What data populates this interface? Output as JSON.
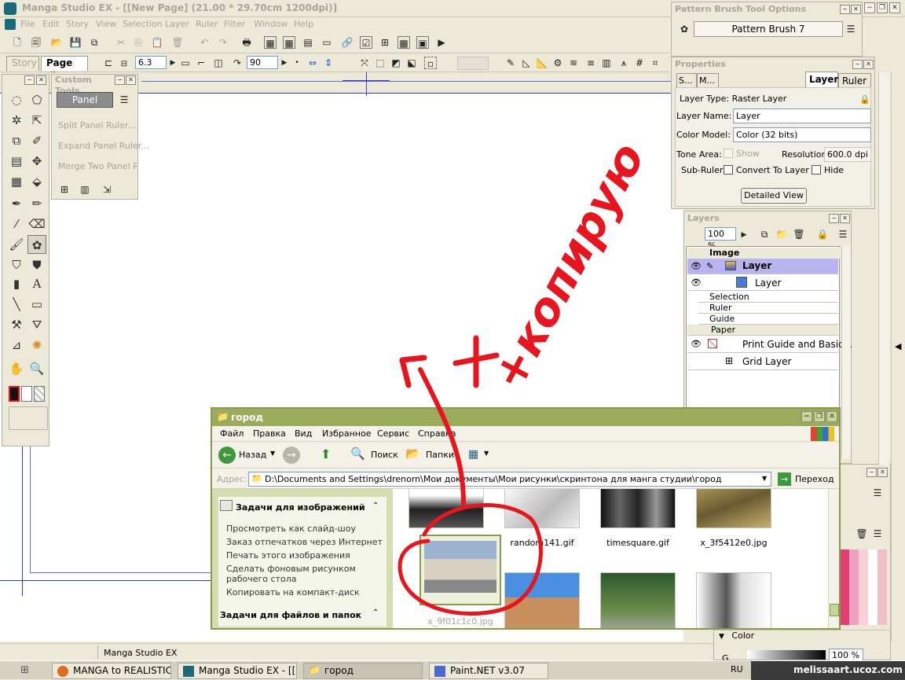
{
  "app": {
    "title": "Manga Studio EX - [[New Page] (21.00 * 29.70cm 1200dpi)]",
    "menu": [
      "File",
      "Edit",
      "Story",
      "View",
      "Selection",
      "Layer",
      "Ruler",
      "Filter",
      "Window",
      "Help"
    ]
  },
  "tabs": {
    "story": "Story",
    "page": "Page",
    "close": "✖"
  },
  "toolbar2": {
    "size_value": "6.3",
    "angle_value": "90"
  },
  "custom_tools": {
    "title": "Custom Tools",
    "panel_label": "Panel",
    "items": [
      "Split Panel Ruler...",
      "Expand Panel Ruler...",
      "Merge Two Panel Ru"
    ]
  },
  "pattern_brush": {
    "title": "Pattern Brush Tool Options",
    "value": "Pattern Brush 7"
  },
  "properties": {
    "title": "Properties",
    "tabs": [
      "S...",
      "M...",
      "Layer",
      "Ruler"
    ],
    "layer_type": "Layer Type: Raster Layer",
    "layer_name_label": "Layer Name:",
    "layer_name": "Layer",
    "color_model_label": "Color Model:",
    "color_model": "Color (32 bits)",
    "tone_area_label": "Tone Area:",
    "show_label": "Show",
    "resolution_label": "Resolution:",
    "resolution": "600.0 dpi",
    "subruler_label": "Sub-Ruler:",
    "convert_label": "Convert To Layer",
    "hide_label": "Hide",
    "detailed_view": "Detailed View"
  },
  "layers": {
    "title": "Layers",
    "opacity": "100 %",
    "image": "Image",
    "layer_selected": "Layer",
    "layer2": "Layer",
    "selection": "Selection",
    "ruler": "Ruler",
    "guide": "Guide",
    "paper": "Paper",
    "print_guide": "Print Guide and Basic...",
    "grid": "Grid Layer"
  },
  "color_panel": {
    "title": "Color",
    "g_label": "G",
    "percent": "100 %"
  },
  "explorer": {
    "title": "город",
    "menu": [
      "Файл",
      "Правка",
      "Вид",
      "Избранное",
      "Сервис",
      "Справка"
    ],
    "back": "Назад",
    "search": "Поиск",
    "folders": "Папки",
    "address_label": "Адрес:",
    "address": "D:\\Documents and Settings\\drenorn\\Мои документы\\Мои рисунки\\скринтона для манга студии\\город",
    "go": "Переход",
    "tasks_title": "Задачи для изображений",
    "tasks": [
      "Просмотреть как слайд-шоу",
      "Заказ отпечатков через Интернет",
      "Печать этого изображения",
      "Сделать фоновым рисунком рабочего стола",
      "Копировать на компакт-диск"
    ],
    "files_title": "Задачи для файлов и папок",
    "files": [
      "random141.gif",
      "timesquare.gif",
      "x_3f5412e0.jpg",
      "x_9f01c1c0.jpg"
    ]
  },
  "annotation": {
    "text": "+копирую"
  },
  "status": {
    "text": "Manga Studio EX"
  },
  "taskbar": {
    "items": [
      "MANGA to REALISTIC:...",
      "Manga Studio EX - [[N...",
      "город",
      "Paint.NET v3.07"
    ],
    "lang": "RU",
    "watermark": "melissaart.ucoz.com"
  },
  "colors": {
    "accent_red": "#e8141e",
    "explorer_title": "#9aac5c",
    "guide_blue": "#2a3fc8",
    "layer_selected": "#b8b4f0"
  }
}
